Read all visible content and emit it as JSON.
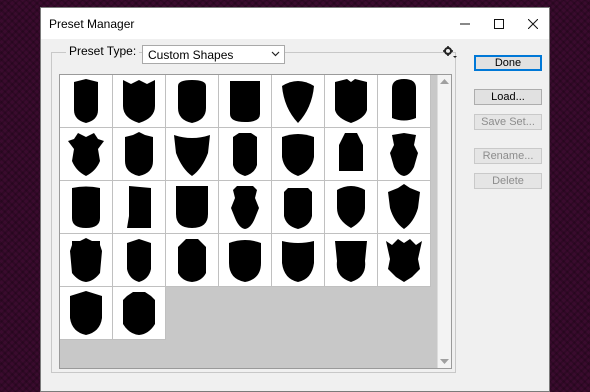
{
  "window": {
    "title": "Preset Manager"
  },
  "titlebar_buttons": [
    {
      "name": "minimize-button",
      "icon": "minimize-icon"
    },
    {
      "name": "maximize-button",
      "icon": "maximize-icon"
    },
    {
      "name": "close-button",
      "icon": "close-icon"
    }
  ],
  "preset": {
    "label": "Preset Type:",
    "value": "Custom Shapes"
  },
  "buttons": {
    "done": "Done",
    "load": "Load...",
    "save_set": "Save Set...",
    "rename": "Rename...",
    "delete": "Delete"
  },
  "colors": {
    "accent": "#0078d7",
    "background": "#3a0b2e",
    "panel": "#f0f0f0"
  },
  "shapes": [
    "shield-1",
    "shield-2",
    "shield-3",
    "shield-4",
    "shield-5",
    "shield-6",
    "shield-7",
    "shield-8",
    "shield-9",
    "shield-10",
    "shield-11",
    "shield-12",
    "shield-13",
    "shield-14",
    "shield-15",
    "shield-16",
    "shield-17",
    "shield-18",
    "shield-19",
    "shield-20",
    "shield-21",
    "shield-22",
    "shield-23",
    "shield-24",
    "shield-25",
    "shield-26",
    "shield-27",
    "shield-28",
    "shield-29",
    "shield-30"
  ]
}
